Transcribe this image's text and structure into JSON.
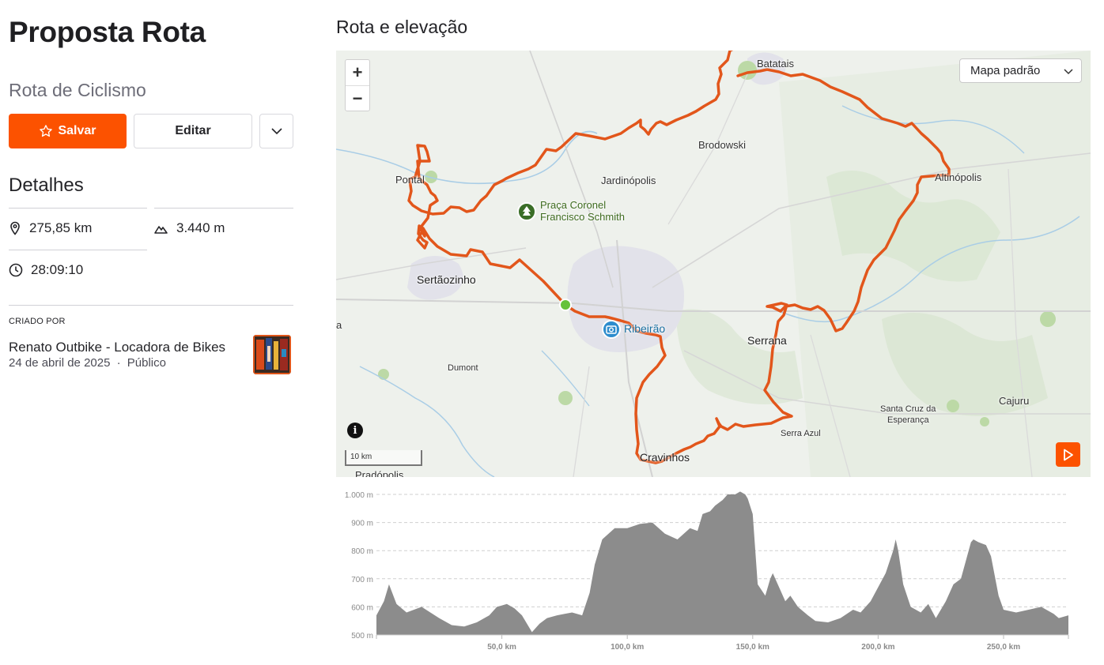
{
  "route": {
    "title": "Proposta Rota",
    "subtitle": "Rota de Ciclismo"
  },
  "actions": {
    "save_label": "Salvar",
    "edit_label": "Editar"
  },
  "details": {
    "heading": "Detalhes",
    "distance": "275,85 km",
    "elevation_gain": "3.440 m",
    "duration": "28:09:10"
  },
  "creator": {
    "label": "CRIADO POR",
    "name": "Renato Outbike - Locadora de Bikes",
    "date": "24 de abril de 2025",
    "separator": "·",
    "visibility": "Público"
  },
  "map": {
    "heading": "Rota e elevação",
    "style_select": "Mapa padrão",
    "scale_label": "10 km",
    "route_color": "#e2561b",
    "places": {
      "batatais": "Batatais",
      "brodowski": "Brodowski",
      "jardinopolis": "Jardinópolis",
      "pontal": "Pontal",
      "altinopolis": "Altinópolis",
      "sertaozinho": "Sertãozinho",
      "serrana": "Serrana",
      "dumont": "Dumont",
      "santa_cruz": "Santa Cruz da",
      "santa_cruz_2": "Esperança",
      "cajuru": "Cajuru",
      "serra_azul": "Serra Azul",
      "cravinhos": "Cravinhos",
      "pradopolis": "Pradópolis",
      "edge_a": "a"
    },
    "poi_park_line1": "Praça Coronel",
    "poi_park_line2": "Francisco Schmith",
    "poi_city": "Ribeirão"
  },
  "chart_data": {
    "type": "area",
    "title": "",
    "xlabel": "",
    "ylabel": "",
    "ylim": [
      500,
      1000
    ],
    "xlim": [
      0,
      275.85
    ],
    "y_ticks": [
      "500 m",
      "600 m",
      "700 m",
      "800 m",
      "900 m",
      "1.000 m"
    ],
    "x_ticks": [
      "50,0 km",
      "100,0 km",
      "150,0 km",
      "200,0 km",
      "250,0 km"
    ],
    "x_tick_values": [
      50,
      100,
      150,
      200,
      250
    ],
    "y_tick_values": [
      500,
      600,
      700,
      800,
      900,
      1000
    ],
    "grid": true,
    "fill_color": "#8c8c8c",
    "x": [
      0,
      3,
      5,
      8,
      12,
      18,
      25,
      30,
      35,
      40,
      45,
      48,
      52,
      55,
      58,
      62,
      65,
      68,
      72,
      75,
      78,
      82,
      85,
      87,
      90,
      95,
      100,
      105,
      110,
      115,
      120,
      125,
      128,
      130,
      133,
      135,
      138,
      140,
      143,
      145,
      147,
      148,
      150,
      152,
      155,
      157,
      158,
      160,
      163,
      165,
      168,
      172,
      175,
      180,
      185,
      190,
      193,
      197,
      200,
      203,
      206,
      207,
      208,
      210,
      213,
      217,
      220,
      223,
      227,
      230,
      233,
      237,
      238,
      240,
      243,
      245,
      248,
      250,
      255,
      260,
      265,
      270,
      272,
      275.85
    ],
    "y": [
      570,
      620,
      680,
      610,
      580,
      600,
      560,
      535,
      530,
      545,
      570,
      600,
      610,
      595,
      570,
      510,
      540,
      560,
      570,
      575,
      580,
      570,
      650,
      750,
      840,
      880,
      880,
      895,
      900,
      860,
      840,
      880,
      870,
      930,
      940,
      960,
      980,
      1000,
      1000,
      1010,
      1000,
      985,
      930,
      680,
      640,
      700,
      720,
      680,
      620,
      640,
      600,
      570,
      550,
      545,
      560,
      590,
      580,
      620,
      670,
      720,
      800,
      840,
      800,
      680,
      600,
      580,
      610,
      560,
      620,
      680,
      700,
      830,
      840,
      830,
      820,
      780,
      640,
      590,
      580,
      590,
      600,
      575,
      560,
      570
    ]
  }
}
